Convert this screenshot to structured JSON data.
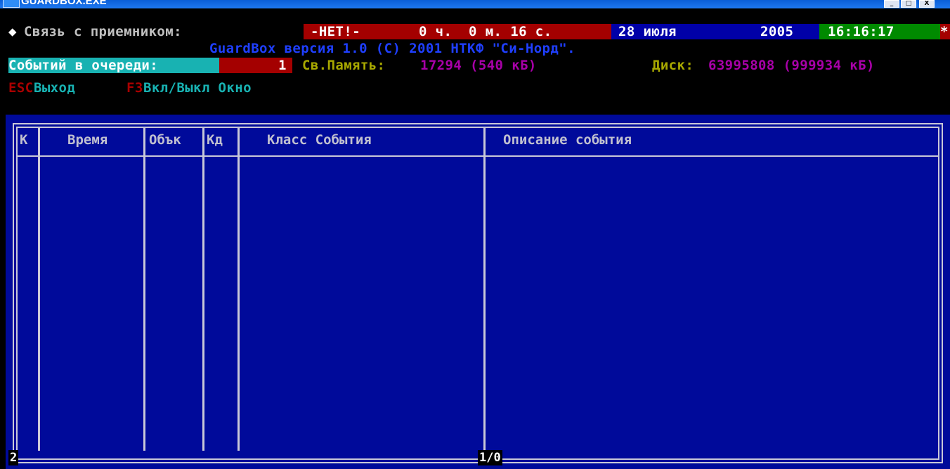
{
  "window": {
    "title": "GUARDBOX.EXE",
    "buttons": [
      "_",
      "□",
      "X"
    ]
  },
  "status": {
    "diamond": "◆",
    "link_label": "Связь с приемником:",
    "link_value": "-НЕТ!-",
    "uptime": "0 ч.  0 м. 16 с.",
    "date": "28 июля",
    "year": "2005",
    "time": "16:16:17",
    "star": "*"
  },
  "version_line": "GuardBox версия 1.0 (С) 2001 НТКФ \"Си-Норд\".",
  "queue": {
    "label": "Событий в очереди:",
    "count": "1",
    "mem_label": "Св.Память:",
    "mem_value": "17294 (540 кБ)",
    "disk_label": "Диск:",
    "disk_value": "63995808 (999934 кБ)"
  },
  "hotkeys": {
    "esc_key": "ESC",
    "esc_label": "Выход",
    "f3_key": "F3",
    "f3_label": "Вкл/Выкл Окно"
  },
  "table": {
    "columns": [
      "К",
      "Время",
      "Обък",
      "Кд",
      "Класс События",
      "Описание события"
    ],
    "rows": []
  },
  "footer": {
    "left": "2",
    "page": "1/0"
  },
  "colors": {
    "panel_bg": "#000a9a",
    "border": "#c8c8d8",
    "red_bg": "#a40000",
    "green_bg": "#008a00",
    "cyan": "#18b2b2"
  }
}
